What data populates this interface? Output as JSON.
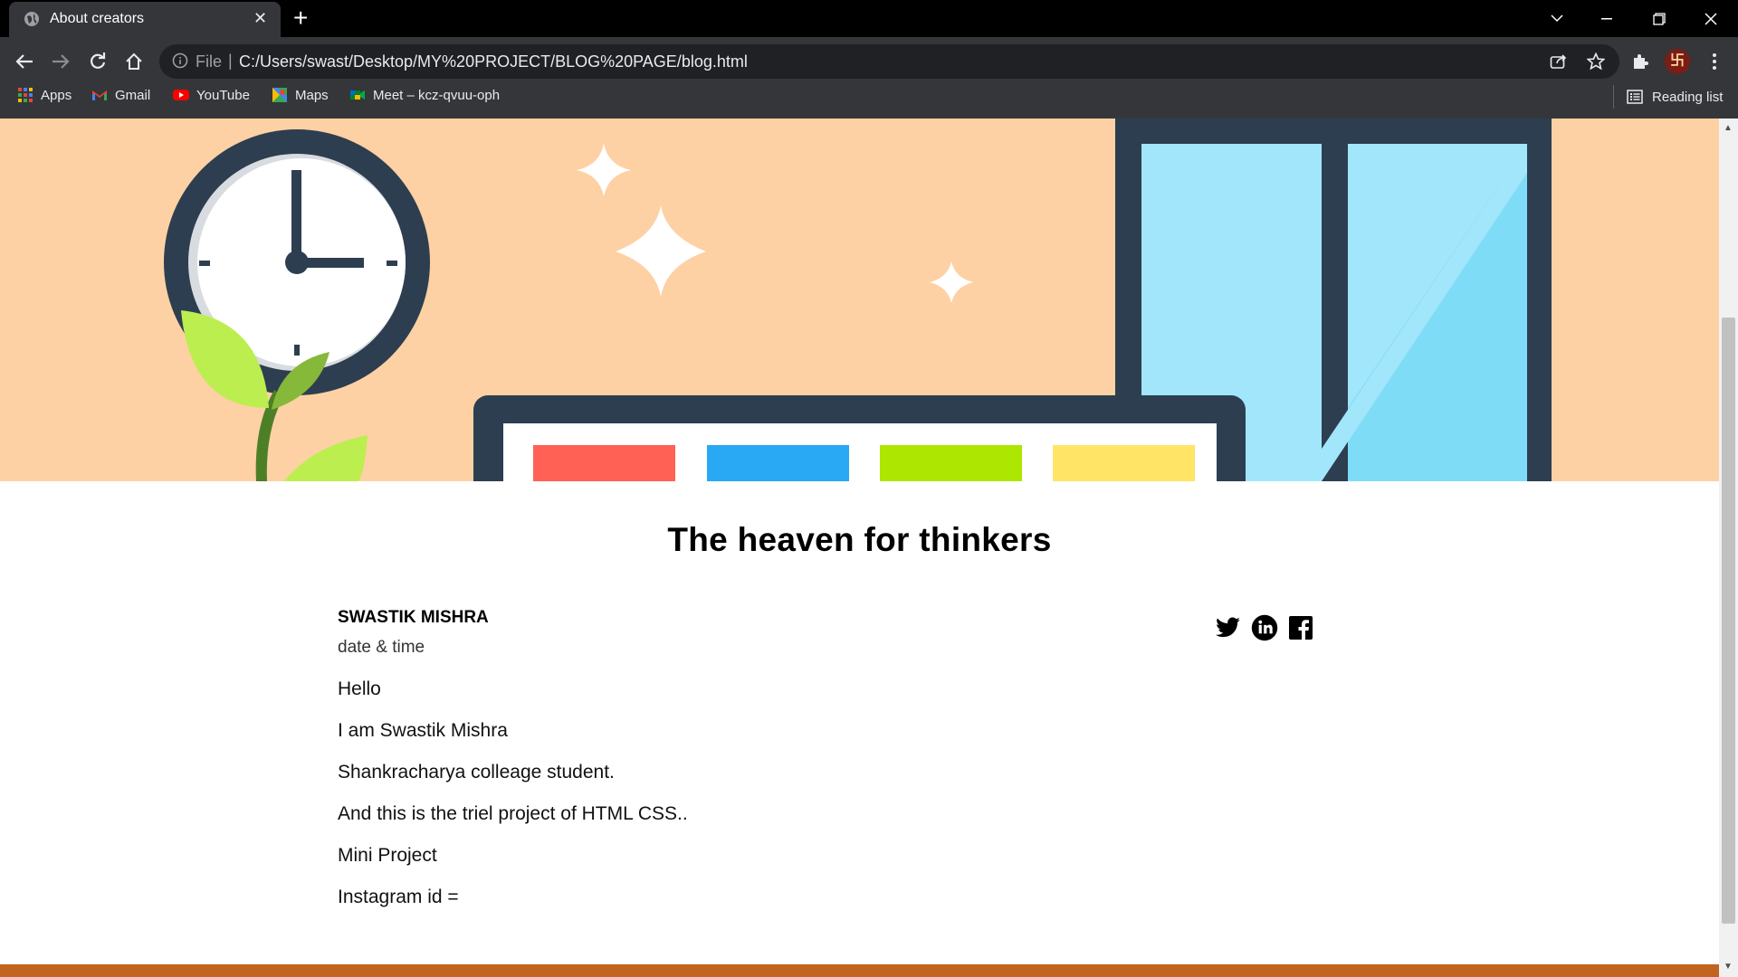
{
  "browser": {
    "tab_title": "About creators",
    "tab_close": "✕",
    "new_tab": "+",
    "address_scheme_label": "File",
    "address_separator": "|",
    "url": "C:/Users/swast/Desktop/MY%20PROJECT/BLOG%20PAGE/blog.html",
    "profile_initial": "卐",
    "bookmarks": [
      {
        "label": "Apps",
        "icon": "apps-grid-icon"
      },
      {
        "label": "Gmail",
        "icon": "gmail-icon"
      },
      {
        "label": "YouTube",
        "icon": "youtube-icon"
      },
      {
        "label": "Maps",
        "icon": "maps-icon"
      },
      {
        "label": "Meet – kcz-qvuu-oph",
        "icon": "meet-icon"
      }
    ],
    "reading_list": "Reading list"
  },
  "colors": {
    "hero_bg": "#fdd1a4",
    "dark_navy": "#2d3e50",
    "window_glass": "#7fdcf7",
    "bar_red": "#ff6155",
    "bar_blue": "#29a8f4",
    "bar_green": "#ade600",
    "bar_yellow": "#ffe466",
    "footer": "#c0641e"
  },
  "page": {
    "headline": "The heaven for thinkers",
    "author": "SWASTIK MISHRA",
    "datetime": "date & time",
    "social_icons": [
      "twitter-icon",
      "linkedin-icon",
      "facebook-icon"
    ],
    "post_lines": [
      "Hello",
      "I am Swastik Mishra",
      "Shankracharya colleage student.",
      "And this is the triel project of HTML CSS..",
      "Mini Project",
      "Instagram id ="
    ]
  }
}
